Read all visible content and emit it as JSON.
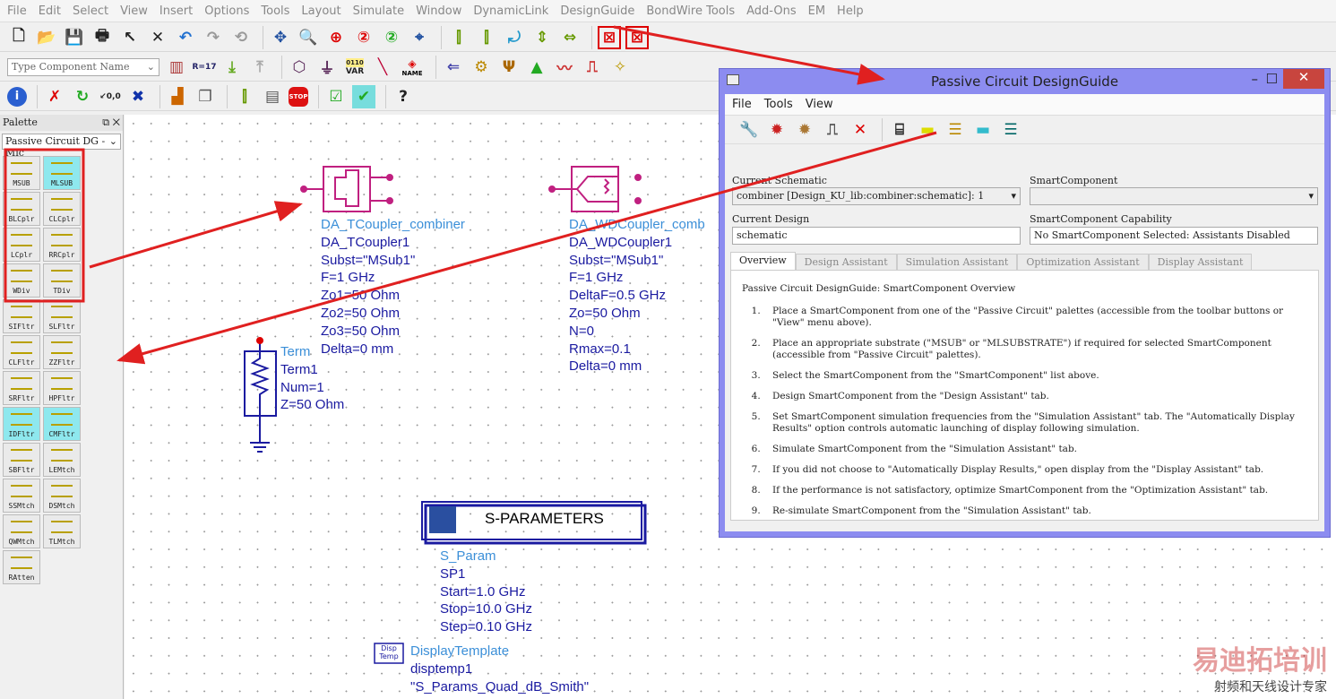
{
  "menu": [
    "File",
    "Edit",
    "Select",
    "View",
    "Insert",
    "Options",
    "Tools",
    "Layout",
    "Simulate",
    "Window",
    "DynamicLink",
    "DesignGuide",
    "BondWire Tools",
    "Add-Ons",
    "EM",
    "Help"
  ],
  "toolbar": {
    "component_placeholder": "Type Component Name",
    "var_label": "VAR",
    "var_num": "0110",
    "name_label": "NAME",
    "r_label": "R=17"
  },
  "palette": {
    "title": "Palette",
    "library": "Passive Circuit DG - Mic",
    "items": [
      "MSUB",
      "MLSUB",
      "BLCplr",
      "CLCplr",
      "LCplr",
      "RRCplr",
      "WDiv",
      "TDiv",
      "SIFltr",
      "SLFltr",
      "CLFltr",
      "ZZFltr",
      "SRFltr",
      "HPFltr",
      "IDFltr",
      "CMFltr",
      "SBFltr",
      "LEMtch",
      "SSMtch",
      "DSMtch",
      "QWMtch",
      "TLMtch",
      "RAtten"
    ]
  },
  "schematic": {
    "tcoupler": [
      "DA_TCoupler_combiner",
      "DA_TCoupler1",
      "Subst=\"MSub1\"",
      "F=1 GHz",
      "Zo1=50 Ohm",
      "Zo2=50 Ohm",
      "Zo3=50 Ohm",
      "Delta=0 mm"
    ],
    "wdcoupler": [
      "DA_WDCoupler_comb",
      "DA_WDCoupler1",
      "Subst=\"MSub1\"",
      "F=1 GHz",
      "DeltaF=0.5 GHz",
      "Zo=50 Ohm",
      "N=0",
      "Rmax=0.1",
      "Delta=0 mm"
    ],
    "term": [
      "Term",
      "Term1",
      "Num=1",
      "Z=50 Ohm"
    ],
    "sparam_title": "S-PARAMETERS",
    "sparam": [
      "S_Param",
      "SP1",
      "Start=1.0 GHz",
      "Stop=10.0 GHz",
      "Step=0.10 GHz"
    ],
    "disp_icon": "Disp Temp",
    "disp": [
      "DisplayTemplate",
      "disptemp1",
      "\"S_Params_Quad_dB_Smith\""
    ]
  },
  "dialog": {
    "title": "Passive Circuit DesignGuide",
    "menu": [
      "File",
      "Tools",
      "View"
    ],
    "current_schematic_label": "Current Schematic",
    "current_schematic": "combiner [Design_KU_lib:combiner:schematic]: 1",
    "smart_component_label": "SmartComponent",
    "smart_component": "",
    "current_design_label": "Current Design",
    "current_design": "schematic",
    "capability_label": "SmartComponent Capability",
    "capability": "No SmartComponent Selected: Assistants Disabled",
    "tabs": [
      "Overview",
      "Design Assistant",
      "Simulation Assistant",
      "Optimization Assistant",
      "Display Assistant"
    ],
    "overview_title": "Passive Circuit DesignGuide: SmartComponent Overview",
    "steps": [
      "Place a SmartComponent from one of the \"Passive Circuit\" palettes (accessible from the toolbar buttons or \"View\" menu above).",
      "Place an appropriate substrate (\"MSUB\" or \"MLSUBSTRATE\") if required for selected SmartComponent (accessible from \"Passive Circuit\" palettes).",
      "Select the SmartComponent from the \"SmartComponent\" list above.",
      "Design SmartComponent from the \"Design Assistant\" tab.",
      "Set SmartComponent simulation frequencies from the \"Simulation Assistant\" tab. The \"Automatically Display Results\" option controls automatic launching of display following simulation.",
      "Simulate SmartComponent from the \"Simulation Assistant\" tab.",
      "If you did not choose to \"Automatically Display Results,\" open display from the \"Display Assistant\" tab.",
      "If the performance is not satisfactory, optimize SmartComponent from the \"Optimization Assistant\" tab.",
      "Re-simulate SmartComponent from the \"Simulation Assistant\" tab."
    ]
  },
  "watermark": {
    "brand": "易迪拓培训",
    "tagline": "射频和天线设计专家"
  },
  "colors": {
    "accent_red": "#e02020",
    "dialog_frame": "#8c8cf0",
    "schematic_text": "#1a1aa0"
  }
}
